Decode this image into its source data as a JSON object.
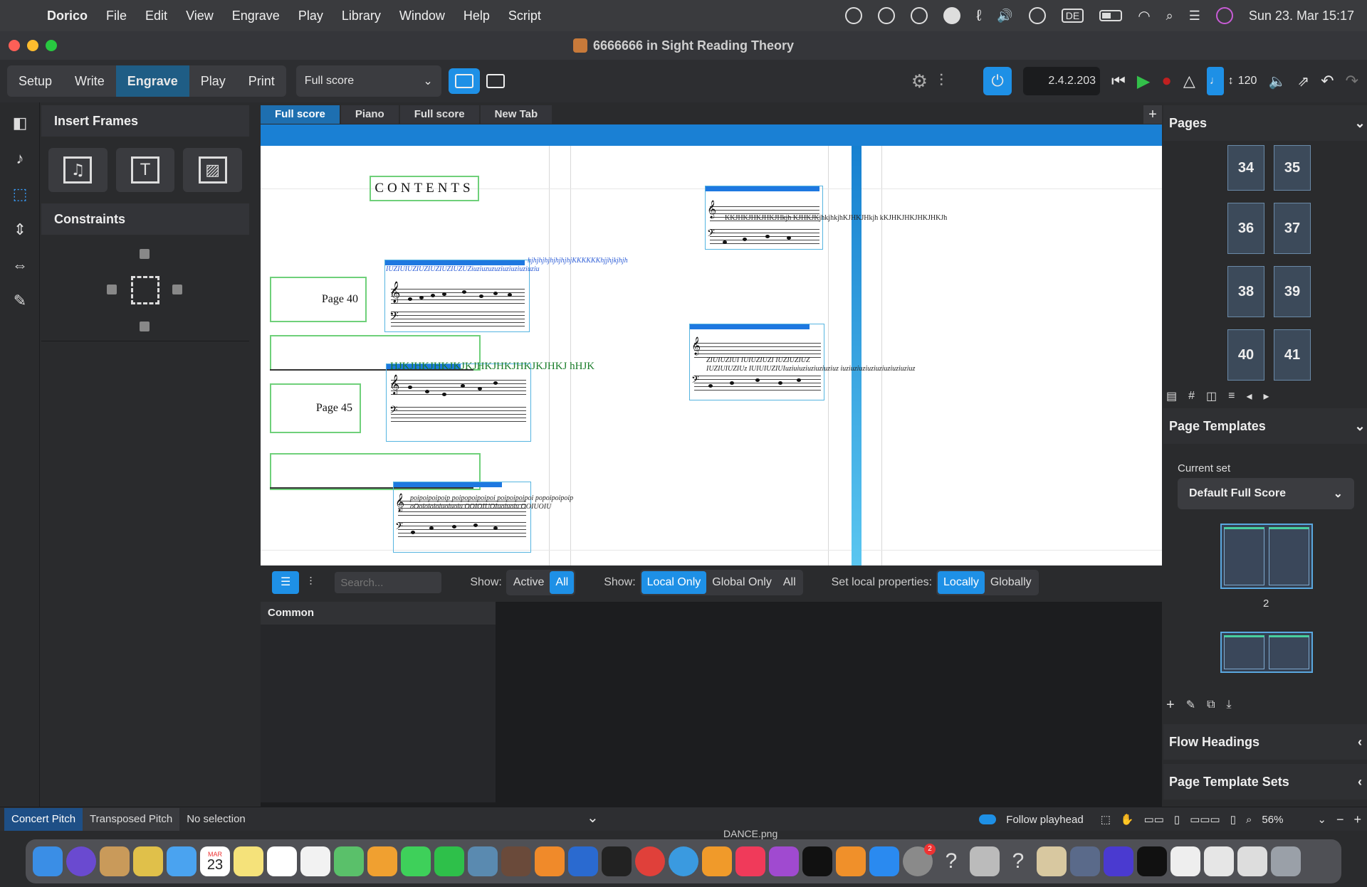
{
  "menubar": {
    "app_name": "Dorico",
    "items": [
      "File",
      "Edit",
      "View",
      "Engrave",
      "Play",
      "Library",
      "Window",
      "Help",
      "Script"
    ],
    "input_source": "DE",
    "datetime": "Sun 23. Mar  15:17"
  },
  "window": {
    "title": "6666666 in  Sight Reading Theory"
  },
  "toolbar": {
    "modes": [
      "Setup",
      "Write",
      "Engrave",
      "Play",
      "Print"
    ],
    "active_mode": "Engrave",
    "layout_select": "Full score",
    "time_display": "2.4.2.203",
    "tempo_value": "120"
  },
  "left_panel": {
    "insert_frames_title": "Insert Frames",
    "frame_icons": [
      "music-frame-icon",
      "text-frame-icon",
      "graphics-frame-icon"
    ],
    "constraints_title": "Constraints"
  },
  "tabs": {
    "items": [
      "Full score",
      "Piano",
      "Full score",
      "New Tab"
    ],
    "active_index": 0,
    "add_label": "+"
  },
  "score": {
    "contents_title": "CONTENTS",
    "page_40_label": "Page  40",
    "page_45_label": "Page 45",
    "staff1_lyrics_line1": "hjhjhjhjhjhjhjhjKKKKKKhjjhjkjhjh",
    "staff1_lyrics_line2": "IUZIUIUZIUZIUZIUZIUZUZiuziuzuzuziuziuziuziuziu",
    "staff2_lyrics": "HJKJHKJHKJKJKJHKJHKJHKJKJHKJ hHJK",
    "staff3_lyrics_line1": "poipoipoipoip poipopoipoipoi poipoipoipoi popoipoipoip",
    "staff3_lyrics_line2": "oOoioioioiuoiuoiu OOIOIUOIuoiuoiu OOIUOIU",
    "staff4_lyrics": "KKJHKJHKJHKJHkjh KJHKJKjhkjhkjhKJHKJHkjh kKJHKJHKJHKJHKJh",
    "staff5_lyrics_line1": "ZIUIUZIUI IUIUZIUZI IUZIUZIUZ",
    "staff5_lyrics_line2": "IUZIUIUZIUz IUIUIUZIUIuziuiuziuziuziuziuz iuziuziuziuziuziuziuziuziuz"
  },
  "properties": {
    "search_placeholder": "Search...",
    "show1_label": "Show:",
    "show1_options": [
      "Active",
      "All"
    ],
    "show1_selected": "All",
    "show2_label": "Show:",
    "show2_options": [
      "Local Only",
      "Global Only",
      "All"
    ],
    "show2_selected": "Local Only",
    "set_local_label": "Set local properties:",
    "set_local_options": [
      "Locally",
      "Globally"
    ],
    "set_local_selected": "Locally",
    "common_group": "Common"
  },
  "right_panel": {
    "pages_title": "Pages",
    "page_numbers": [
      "34",
      "35",
      "36",
      "37",
      "38",
      "39",
      "40",
      "41"
    ],
    "page_templates_title": "Page Templates",
    "current_set_label": "Current set",
    "current_set_value": "Default Full Score",
    "template_number": "2",
    "flow_headings_title": "Flow Headings",
    "page_template_sets_title": "Page Template Sets"
  },
  "statusbar": {
    "concert_pitch": "Concert Pitch",
    "transposed_pitch": "Transposed Pitch",
    "selection": "No selection",
    "follow_playhead": "Follow playhead",
    "zoom": "56%"
  },
  "dock": {
    "hover_label": "DANCE.png",
    "calendar_month": "MAR",
    "calendar_day": "23",
    "badge_count": "2"
  }
}
